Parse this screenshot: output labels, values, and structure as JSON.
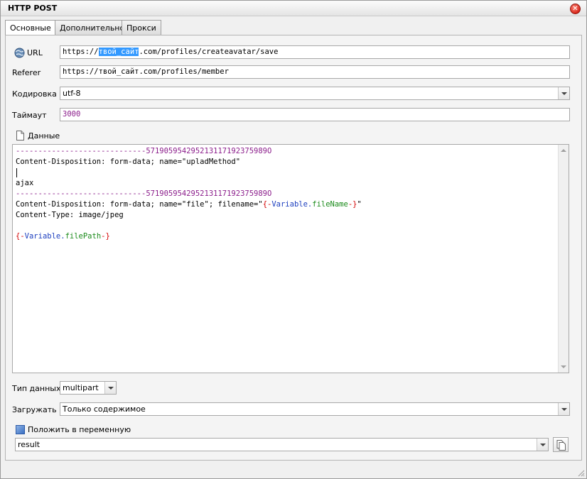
{
  "window": {
    "title": "HTTP POST"
  },
  "tabs": [
    {
      "label": "Основные",
      "active": true
    },
    {
      "label": "Дополнительно",
      "active": false
    },
    {
      "label": "Прокси",
      "active": false
    }
  ],
  "url": {
    "label": "URL",
    "value_prefix": "https://",
    "value_selected": "твой_сайт",
    "value_suffix": ".com/profiles/createavatar/save",
    "icon": "globe-icon"
  },
  "referer": {
    "label": "Referer",
    "value": "https://твой_сайт.com/profiles/member"
  },
  "encoding": {
    "label": "Кодировка",
    "value": "utf-8"
  },
  "timeout": {
    "label": "Таймаут",
    "value": "3000"
  },
  "data": {
    "label": "Данные",
    "icon": "document-icon",
    "boundary": "-----------------------------571905954295213117192375989O",
    "line_disposition_1_a": "Content-Disposition: form-data; name=\"upladMethod\"",
    "line_ajax": "ajax",
    "line_disposition_2_a": "Content-Disposition: form-data; name=\"file\"; filename=\"",
    "var_open": "{-",
    "var_filename_prefix": "Variable.",
    "var_filename_name": "fileName",
    "var_close": "-}",
    "line_disposition_2_end": "\"",
    "line_content_type": "Content-Type: image/jpeg",
    "var_filepath_name": "filePath"
  },
  "data_type": {
    "label": "Тип данных",
    "value": "multipart"
  },
  "load": {
    "label": "Загружать",
    "value": "Только содержимое"
  },
  "put_in_variable": {
    "label": "Положить в переменную",
    "checked": true,
    "value": "result"
  },
  "colors": {
    "accent": "#3399ff",
    "boundary": "#8b1d8b",
    "var_brace": "#d40000",
    "var_ns": "#1d3fbf",
    "var_name": "#1a8a1a"
  }
}
